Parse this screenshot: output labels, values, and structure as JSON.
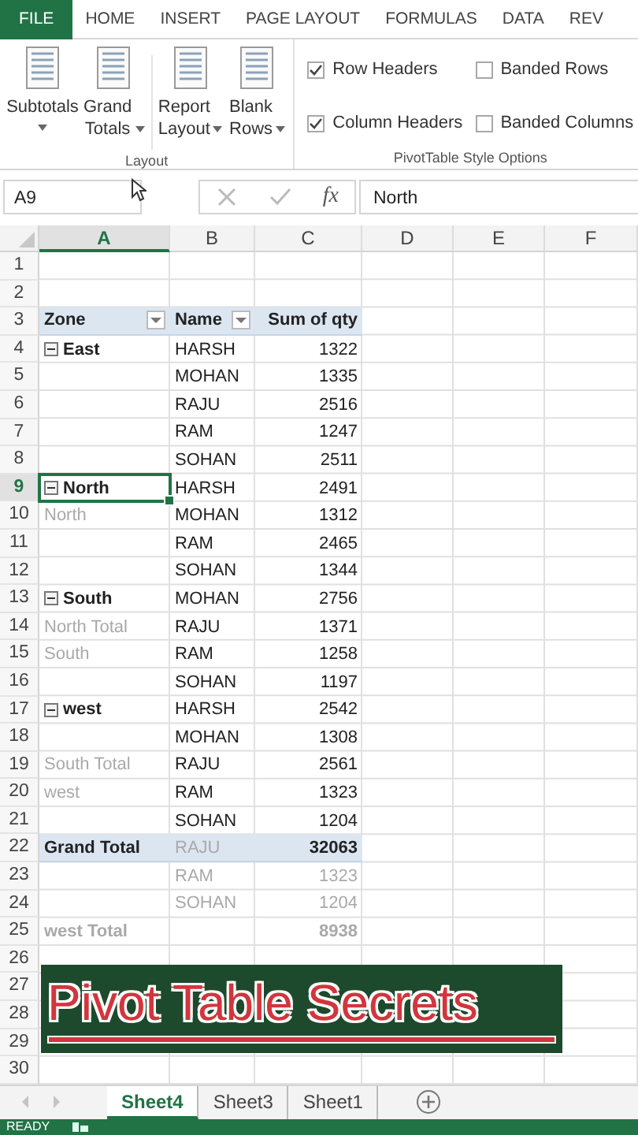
{
  "ribbon_tabs": [
    {
      "label": "FILE",
      "selected": true
    },
    {
      "label": "HOME",
      "selected": false
    },
    {
      "label": "INSERT",
      "selected": false
    },
    {
      "label": "PAGE LAYOUT",
      "selected": false
    },
    {
      "label": "FORMULAS",
      "selected": false
    },
    {
      "label": "DATA",
      "selected": false
    },
    {
      "label": "REV",
      "selected": false
    }
  ],
  "layout_group": {
    "label": "Layout",
    "buttons": [
      {
        "lines": [
          "Subtotals"
        ],
        "dropdown": true
      },
      {
        "lines": [
          "Grand",
          "Totals"
        ],
        "dropdown": true
      },
      {
        "lines": [
          "Report",
          "Layout"
        ],
        "dropdown": true
      },
      {
        "lines": [
          "Blank",
          "Rows"
        ],
        "dropdown": true
      }
    ]
  },
  "style_options": {
    "label": "PivotTable Style Options",
    "options": [
      {
        "label": "Row Headers",
        "checked": true
      },
      {
        "label": "Banded Rows",
        "checked": false
      },
      {
        "label": "Column Headers",
        "checked": true
      },
      {
        "label": "Banded Columns",
        "checked": false
      }
    ]
  },
  "formula_bar": {
    "name_box": "A9",
    "function_label": "fx",
    "formula": "North"
  },
  "columns": [
    {
      "label": "A",
      "selected": true
    },
    {
      "label": "B",
      "selected": false
    },
    {
      "label": "C",
      "selected": false
    },
    {
      "label": "D",
      "selected": false
    },
    {
      "label": "E",
      "selected": false
    },
    {
      "label": "F",
      "selected": false
    }
  ],
  "rows": [
    {
      "number": "1",
      "selected": false,
      "cells": [
        null,
        null,
        null
      ]
    },
    {
      "number": "2",
      "selected": false,
      "cells": [
        null,
        null,
        null
      ]
    },
    {
      "number": "3",
      "selected": false,
      "cells": [
        {
          "text": "Zone",
          "kind": "heading",
          "filter": true
        },
        {
          "text": "Name",
          "kind": "heading",
          "filter": true
        },
        {
          "text": "Sum of qty",
          "kind": "heading"
        }
      ]
    },
    {
      "number": "4",
      "selected": false,
      "cells": [
        {
          "text": "East",
          "kind": "zone",
          "expanded": true
        },
        {
          "text": "HARSH",
          "kind": "item"
        },
        {
          "text": "1322",
          "kind": "item"
        }
      ]
    },
    {
      "number": "5",
      "selected": false,
      "cells": [
        null,
        {
          "text": "MOHAN",
          "kind": "item"
        },
        {
          "text": "1335",
          "kind": "item"
        }
      ]
    },
    {
      "number": "6",
      "selected": false,
      "cells": [
        null,
        {
          "text": "RAJU",
          "kind": "item"
        },
        {
          "text": "2516",
          "kind": "item"
        }
      ]
    },
    {
      "number": "7",
      "selected": false,
      "cells": [
        null,
        {
          "text": "RAM",
          "kind": "item"
        },
        {
          "text": "1247",
          "kind": "item"
        }
      ]
    },
    {
      "number": "8",
      "selected": false,
      "cells": [
        null,
        {
          "text": "SOHAN",
          "kind": "item"
        },
        {
          "text": "2511",
          "kind": "item"
        }
      ]
    },
    {
      "number": "9",
      "selected": true,
      "cells": [
        {
          "text": "North",
          "kind": "zone",
          "expanded": true
        },
        {
          "text": "HARSH",
          "kind": "item"
        },
        {
          "text": "2491",
          "kind": "item"
        }
      ]
    },
    {
      "number": "10",
      "selected": false,
      "cells": [
        {
          "text": "North",
          "kind": "ghost"
        },
        {
          "text": "MOHAN",
          "kind": "item"
        },
        {
          "text": "1312",
          "kind": "item"
        }
      ]
    },
    {
      "number": "11",
      "selected": false,
      "cells": [
        null,
        {
          "text": "RAM",
          "kind": "item"
        },
        {
          "text": "2465",
          "kind": "item"
        }
      ]
    },
    {
      "number": "12",
      "selected": false,
      "cells": [
        null,
        {
          "text": "SOHAN",
          "kind": "item"
        },
        {
          "text": "1344",
          "kind": "item"
        }
      ]
    },
    {
      "number": "13",
      "selected": false,
      "cells": [
        {
          "text": "South",
          "kind": "zone",
          "expanded": true
        },
        {
          "text": "MOHAN",
          "kind": "item"
        },
        {
          "text": "2756",
          "kind": "item"
        }
      ]
    },
    {
      "number": "14",
      "selected": false,
      "cells": [
        {
          "text": "North Total",
          "kind": "ghost"
        },
        {
          "text": "RAJU",
          "kind": "item"
        },
        {
          "text": "1371",
          "kind": "item"
        }
      ]
    },
    {
      "number": "15",
      "selected": false,
      "cells": [
        {
          "text": "South",
          "kind": "ghost"
        },
        {
          "text": "RAM",
          "kind": "item"
        },
        {
          "text": "1258",
          "kind": "item"
        }
      ]
    },
    {
      "number": "16",
      "selected": false,
      "cells": [
        null,
        {
          "text": "SOHAN",
          "kind": "item"
        },
        {
          "text": "1197",
          "kind": "item"
        }
      ]
    },
    {
      "number": "17",
      "selected": false,
      "cells": [
        {
          "text": "west",
          "kind": "zone",
          "expanded": true
        },
        {
          "text": "HARSH",
          "kind": "item"
        },
        {
          "text": "2542",
          "kind": "item"
        }
      ]
    },
    {
      "number": "18",
      "selected": false,
      "cells": [
        null,
        {
          "text": "MOHAN",
          "kind": "item"
        },
        {
          "text": "1308",
          "kind": "item"
        }
      ]
    },
    {
      "number": "19",
      "selected": false,
      "cells": [
        {
          "text": "South Total",
          "kind": "ghost"
        },
        {
          "text": "RAJU",
          "kind": "item"
        },
        {
          "text": "2561",
          "kind": "item"
        }
      ]
    },
    {
      "number": "20",
      "selected": false,
      "cells": [
        {
          "text": "west",
          "kind": "ghost"
        },
        {
          "text": "RAM",
          "kind": "item"
        },
        {
          "text": "1323",
          "kind": "item"
        }
      ]
    },
    {
      "number": "21",
      "selected": false,
      "cells": [
        null,
        {
          "text": "SOHAN",
          "kind": "item"
        },
        {
          "text": "1204",
          "kind": "item"
        }
      ]
    },
    {
      "number": "22",
      "selected": false,
      "cells": [
        {
          "text": "Grand Total",
          "kind": "total"
        },
        {
          "text": "RAJU",
          "kind": "ghost"
        },
        {
          "text": "32063",
          "kind": "total"
        }
      ]
    },
    {
      "number": "23",
      "selected": false,
      "cells": [
        null,
        {
          "text": "RAM",
          "kind": "ghost"
        },
        {
          "text": "1323",
          "kind": "ghost"
        }
      ]
    },
    {
      "number": "24",
      "selected": false,
      "cells": [
        null,
        {
          "text": "SOHAN",
          "kind": "ghost"
        },
        {
          "text": "1204",
          "kind": "ghost"
        }
      ]
    },
    {
      "number": "25",
      "selected": false,
      "cells": [
        {
          "text": "west Total",
          "kind": "ghost-total"
        },
        null,
        {
          "text": "8938",
          "kind": "ghost-total"
        }
      ]
    },
    {
      "number": "26",
      "selected": false,
      "cells": [
        null,
        null,
        null
      ]
    },
    {
      "number": "27",
      "selected": false,
      "cells": [
        null,
        null,
        null
      ]
    },
    {
      "number": "28",
      "selected": false,
      "cells": [
        null,
        null,
        null
      ]
    },
    {
      "number": "29",
      "selected": false,
      "cells": [
        null,
        null,
        null
      ]
    },
    {
      "number": "30",
      "selected": false,
      "cells": [
        null,
        null,
        null
      ]
    }
  ],
  "banner": {
    "text": "Pivot Table Secrets"
  },
  "sheet_tabs": [
    {
      "label": "Sheet4",
      "selected": true
    },
    {
      "label": "Sheet3",
      "selected": false
    },
    {
      "label": "Sheet1",
      "selected": false
    }
  ],
  "status_bar": {
    "mode": "READY"
  }
}
